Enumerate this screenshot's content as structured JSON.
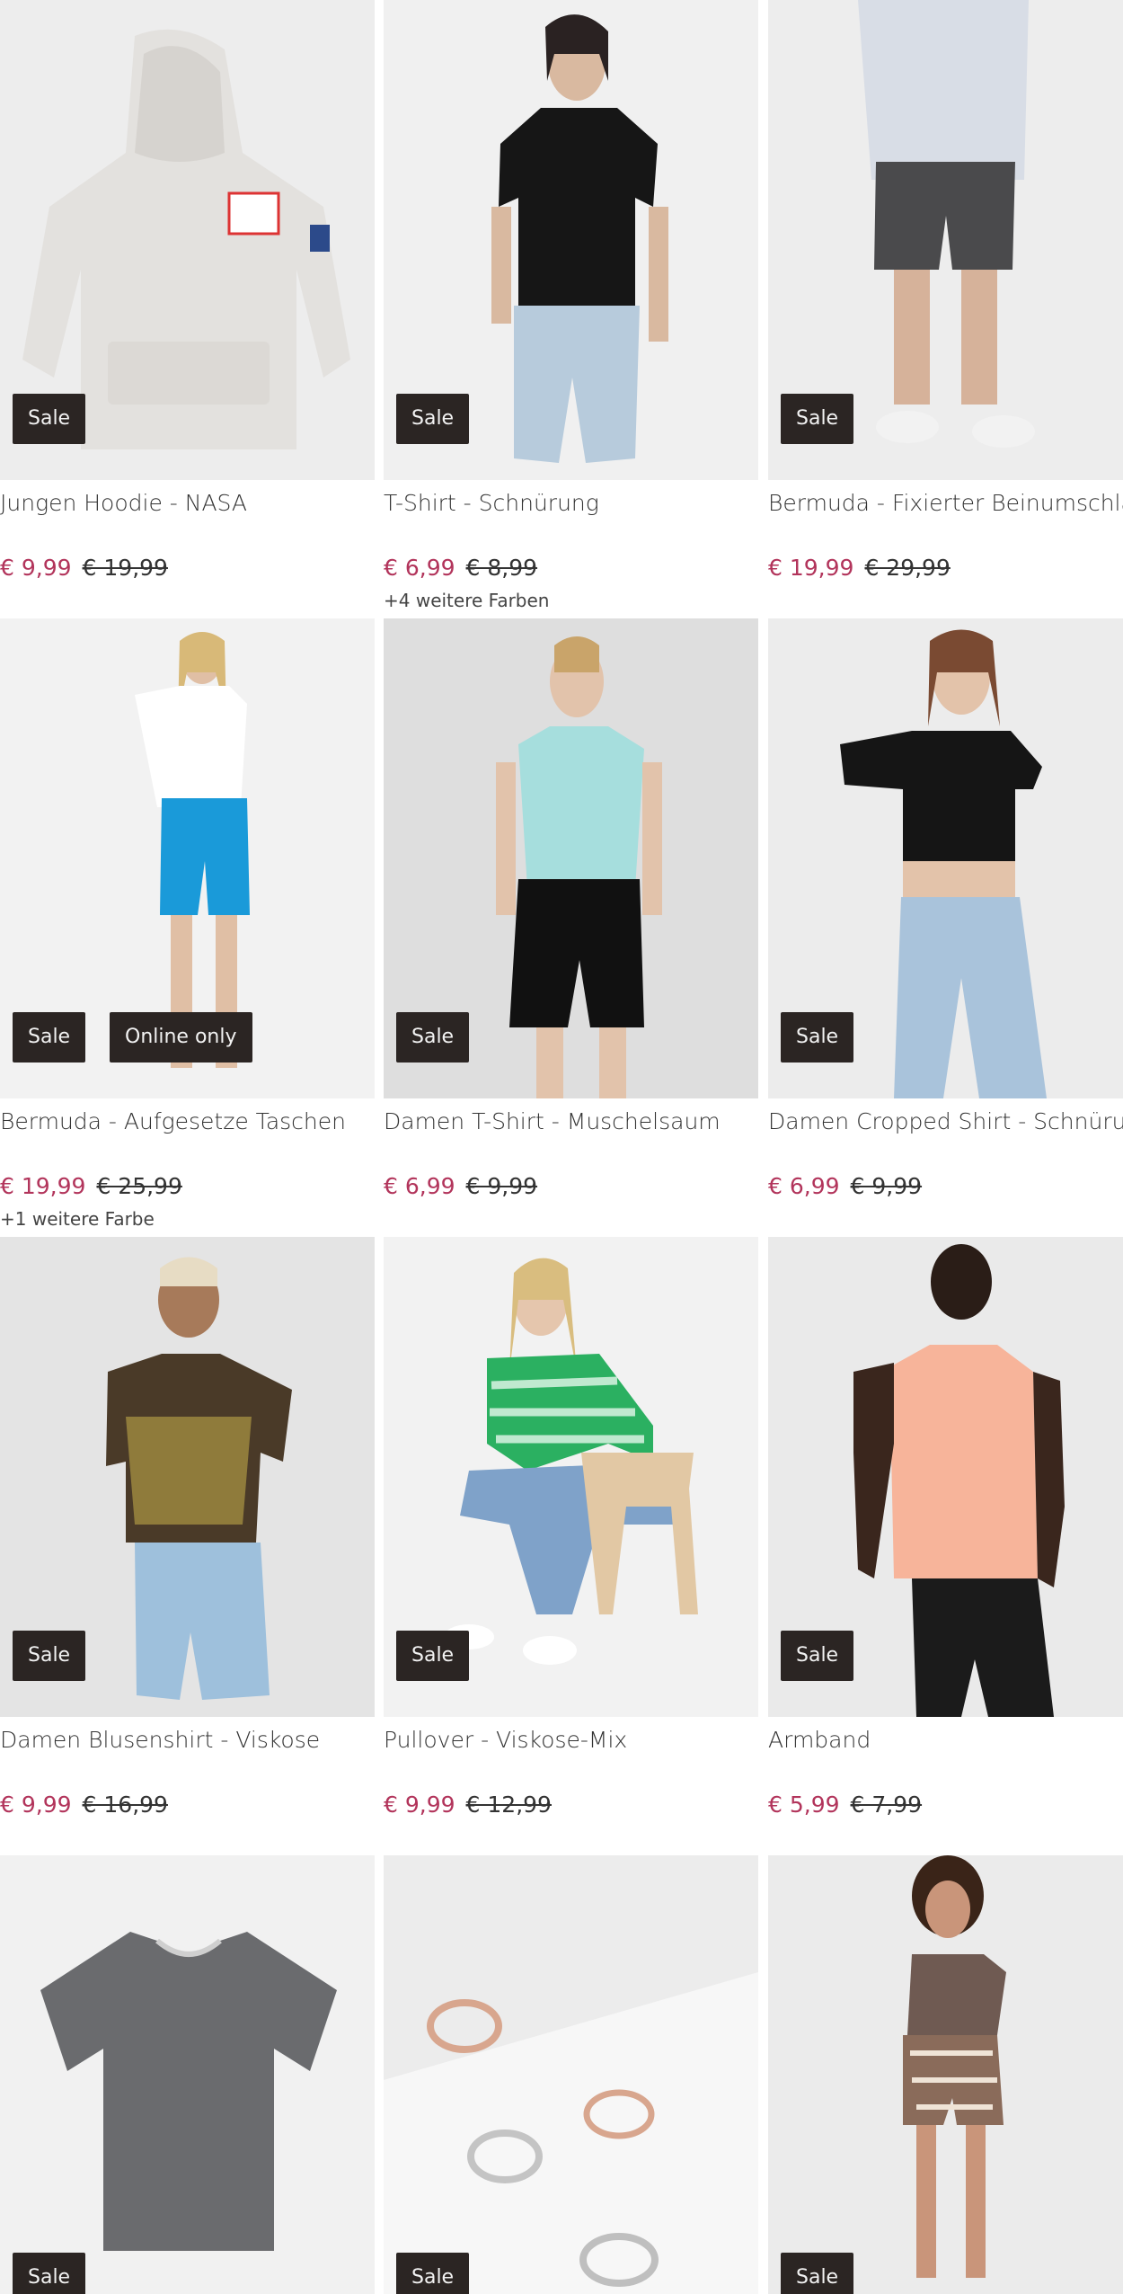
{
  "products": [
    {
      "title": "Jungen Hoodie - NASA",
      "price": "€ 9,99",
      "old_price": "€ 19,99",
      "badge": "Sale",
      "colors": ""
    },
    {
      "title": "T-Shirt - Schnürung",
      "price": "€ 6,99",
      "old_price": "€ 8,99",
      "badge": "Sale",
      "colors": "+4 weitere Farben"
    },
    {
      "title": "Bermuda - Fixierter Beinumschlag",
      "price": "€ 19,99",
      "old_price": "€ 29,99",
      "badge": "Sale",
      "colors": ""
    },
    {
      "title": "Bermuda - Aufgesetze Taschen",
      "price": "€ 19,99",
      "old_price": "€ 25,99",
      "badge": "Sale",
      "badge2": "Online only",
      "colors": "+1 weitere Farbe"
    },
    {
      "title": "Damen T-Shirt - Muschelsaum",
      "price": "€ 6,99",
      "old_price": "€ 9,99",
      "badge": "Sale",
      "colors": ""
    },
    {
      "title": "Damen Cropped Shirt - Schnürung",
      "price": "€ 6,99",
      "old_price": "€ 9,99",
      "badge": "Sale",
      "colors": ""
    },
    {
      "title": "Damen Blusenshirt - Viskose",
      "price": "€ 9,99",
      "old_price": "€ 16,99",
      "badge": "Sale",
      "colors": ""
    },
    {
      "title": "Pullover - Viskose-Mix",
      "price": "€ 9,99",
      "old_price": "€ 12,99",
      "badge": "Sale",
      "colors": ""
    },
    {
      "title": "Armband",
      "price": "€ 5,99",
      "old_price": "€ 7,99",
      "badge": "Sale",
      "colors": ""
    },
    {
      "title": "",
      "price": "",
      "old_price": "",
      "badge": "Sale",
      "colors": ""
    },
    {
      "title": "",
      "price": "",
      "old_price": "",
      "badge": "Sale",
      "colors": ""
    },
    {
      "title": "",
      "price": "",
      "old_price": "",
      "badge": "Sale",
      "colors": ""
    }
  ],
  "colors": {
    "sale_price": "#b2345b",
    "badge_bg": "#2b2523"
  }
}
